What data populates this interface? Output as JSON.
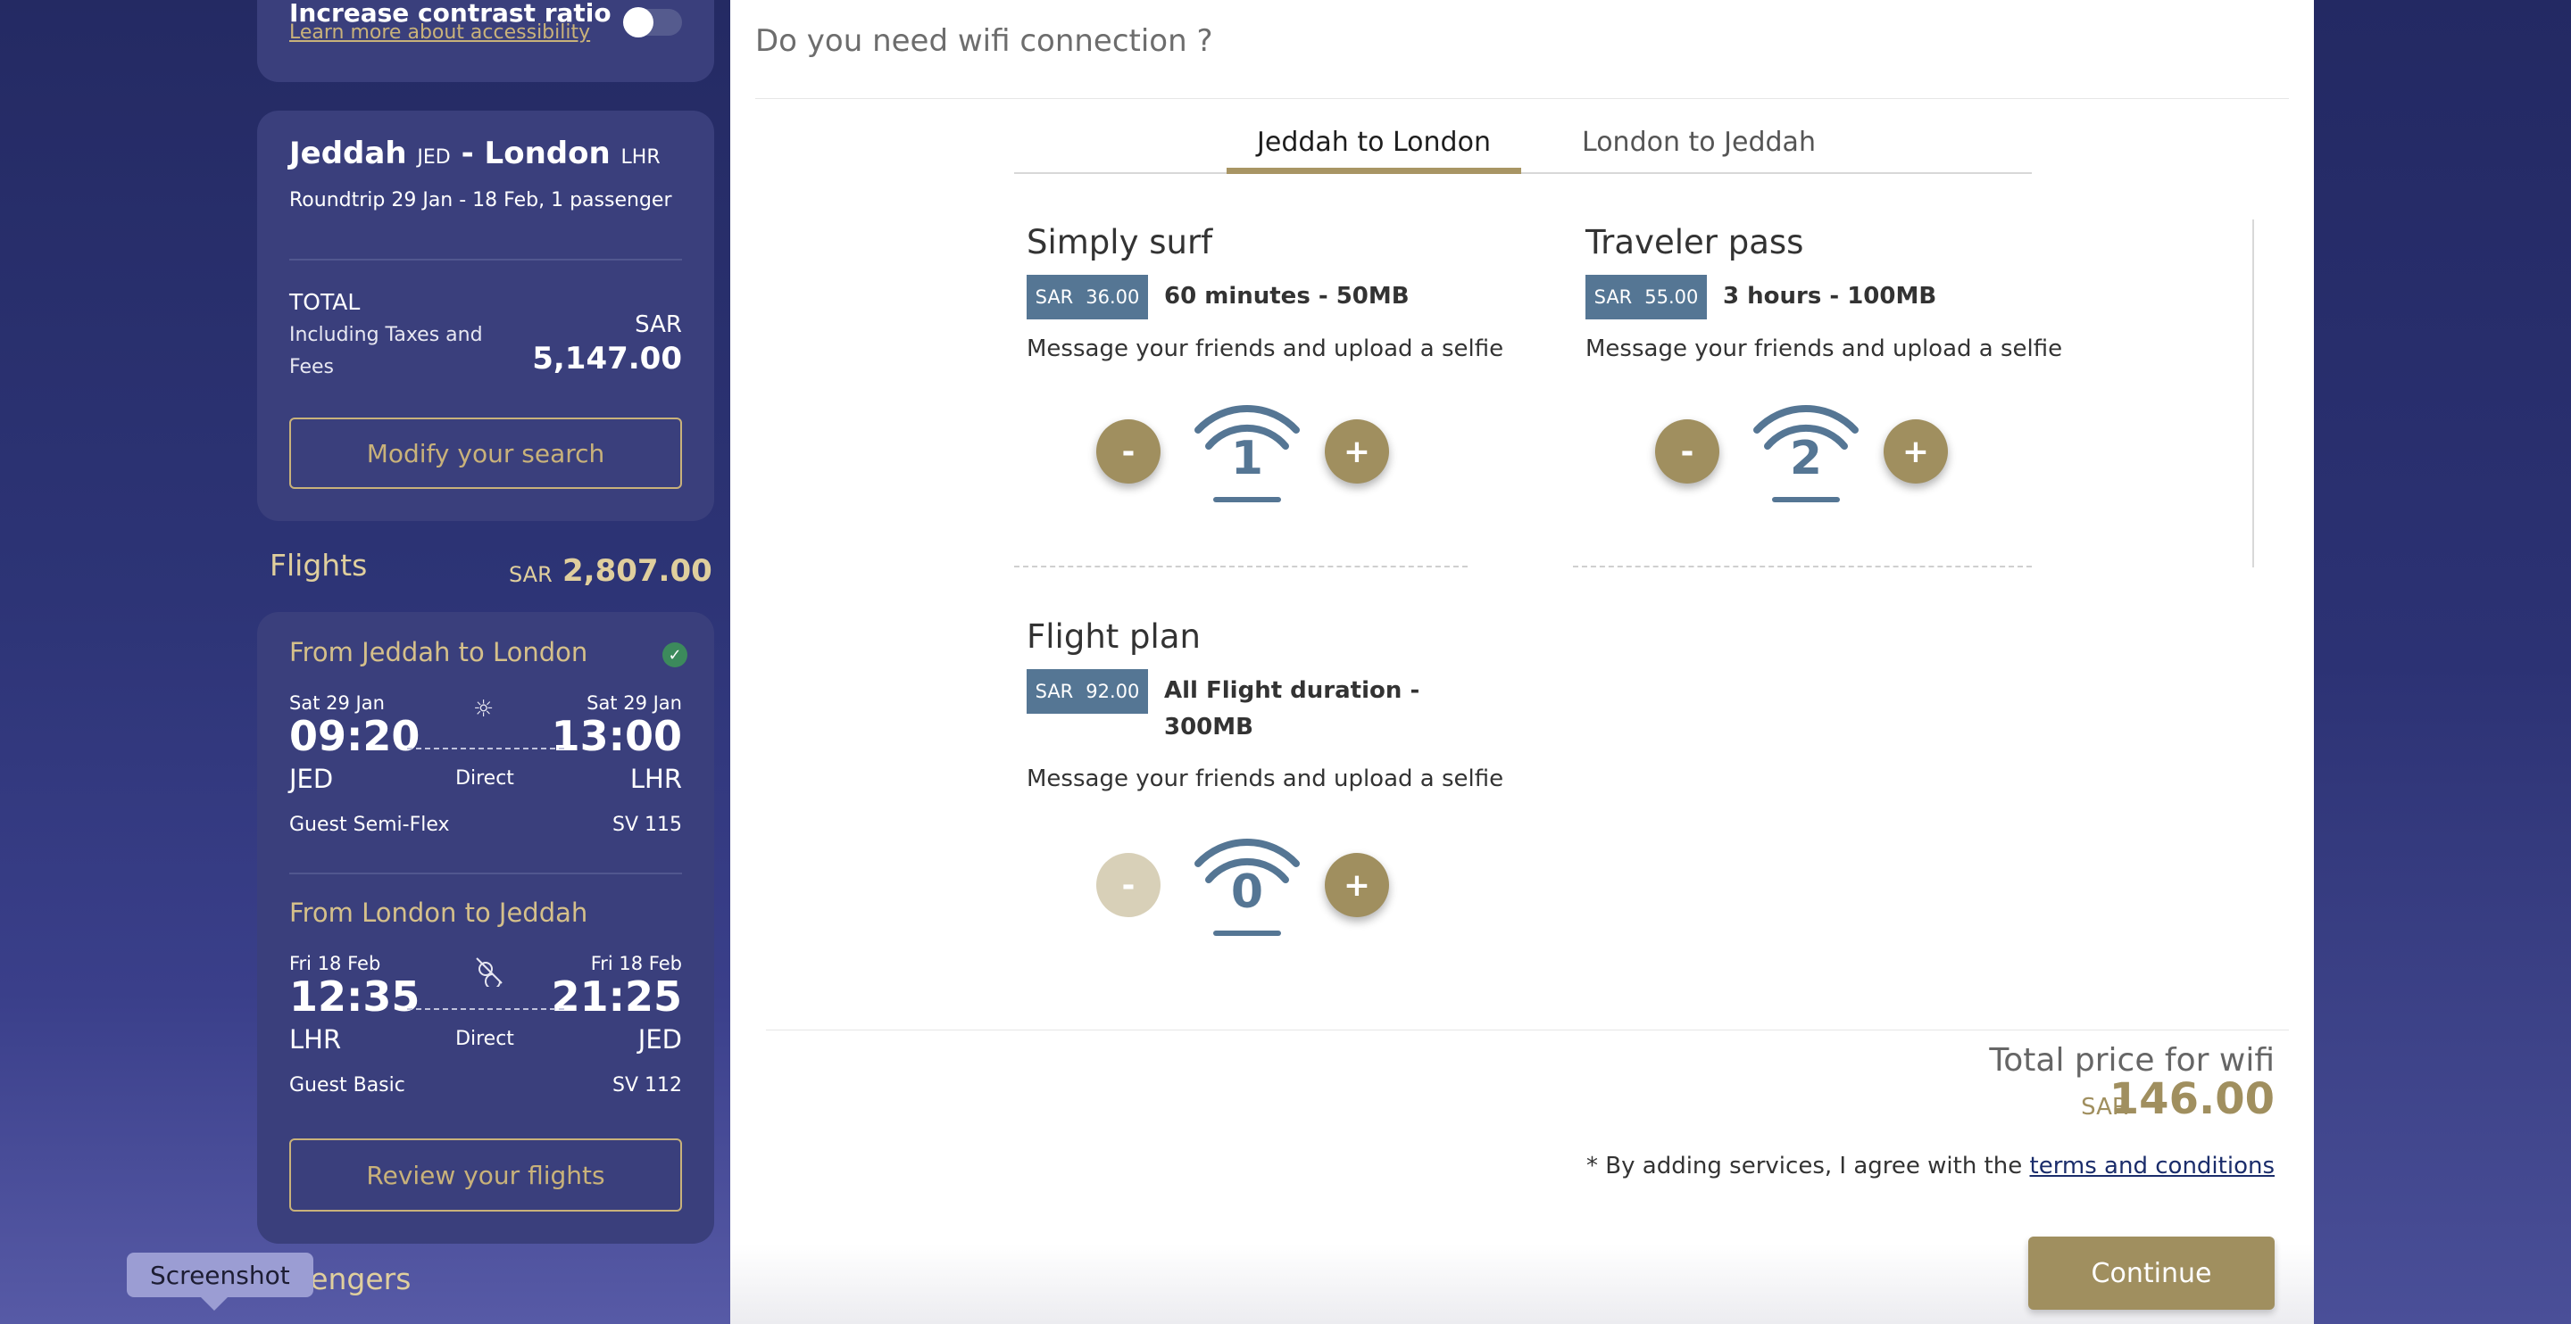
{
  "accessibility": {
    "title": "Increase contrast ratio",
    "link": "Learn more about accessibility",
    "toggle_on": false
  },
  "summary": {
    "origin_city": "Jeddah",
    "origin_code": "JED",
    "route_sep": "-",
    "dest_city": "London",
    "dest_code": "LHR",
    "trip_info": "Roundtrip 29 Jan - 18 Feb, 1 passenger",
    "total_label": "TOTAL",
    "total_sub": "Including Taxes and Fees",
    "currency": "SAR",
    "total_amount": "5,147.00",
    "modify_label": "Modify your search"
  },
  "flights": {
    "heading": "Flights",
    "currency": "SAR",
    "price": "2,807.00",
    "segments": [
      {
        "title": "From Jeddah to London",
        "dep_date": "Sat 29 Jan",
        "arr_date": "Sat 29 Jan",
        "dep_time": "09:20",
        "arr_time": "13:00",
        "dep_code": "JED",
        "arr_code": "LHR",
        "stops": "Direct",
        "fare": "Guest Semi-Flex",
        "flight_no": "SV 115",
        "icon": "sun-icon",
        "selected": true
      },
      {
        "title": "From London to Jeddah",
        "dep_date": "Fri 18 Feb",
        "arr_date": "Fri 18 Feb",
        "dep_time": "12:35",
        "arr_time": "21:25",
        "dep_code": "LHR",
        "arr_code": "JED",
        "stops": "Direct",
        "fare": "Guest Basic",
        "flight_no": "SV 112",
        "icon": "sun-moon-icon",
        "selected": false
      }
    ],
    "review_label": "Review your flights"
  },
  "passengers_heading": "sengers",
  "tooltip": "Screenshot",
  "wifi": {
    "question": "Do you need wifi connection ?",
    "tabs": [
      "Jeddah to London",
      "London to Jeddah"
    ],
    "active_tab": 0,
    "plans": [
      {
        "title": "Simply surf",
        "currency": "SAR",
        "price": "36.00",
        "desc": "60 minutes - 50MB",
        "message": "Message your friends and upload a selfie",
        "quantity": "1",
        "minus": "-",
        "plus": "+"
      },
      {
        "title": "Traveler pass",
        "currency": "SAR",
        "price": "55.00",
        "desc": "3 hours - 100MB",
        "message": "Message your friends and upload a selfie",
        "quantity": "2",
        "minus": "-",
        "plus": "+"
      },
      {
        "title": "Flight plan",
        "currency": "SAR",
        "price": "92.00",
        "desc": "All Flight duration - 300MB",
        "message": "Message your friends and upload a selfie",
        "quantity": "0",
        "minus": "-",
        "plus": "+"
      }
    ],
    "total_label": "Total price for wifi",
    "total_currency": "SAR",
    "total_amount": "146.00",
    "terms_text": "* By adding services, I agree with the",
    "terms_link": "terms and conditions",
    "continue_label": "Continue"
  },
  "colors": {
    "accent_gold": "#a08f5f",
    "price_tag_blue": "#557694",
    "sidebar_card": "#3a3f7c"
  }
}
